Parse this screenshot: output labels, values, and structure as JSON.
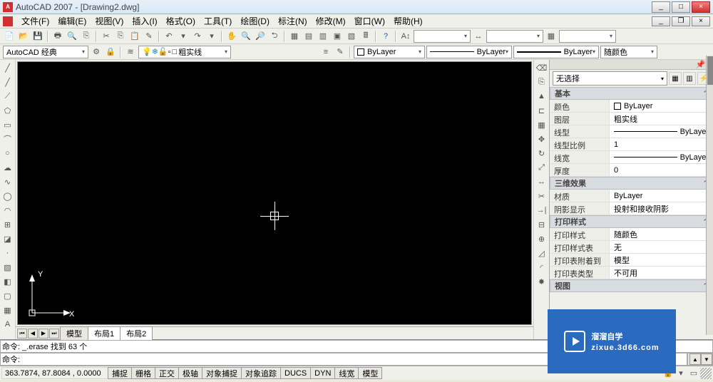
{
  "title": "AutoCAD 2007 - [Drawing2.dwg]",
  "menus": [
    "文件(F)",
    "编辑(E)",
    "视图(V)",
    "插入(I)",
    "格式(O)",
    "工具(T)",
    "绘图(D)",
    "标注(N)",
    "修改(M)",
    "窗口(W)",
    "帮助(H)"
  ],
  "workspace_combo": "AutoCAD 经典",
  "layer_combo": "粗实线",
  "color_combo": "随颜色",
  "line_panel": {
    "color": "ByLayer",
    "ltype": "ByLayer",
    "lweight": "ByLayer"
  },
  "tabs": {
    "items": [
      "模型",
      "布局1",
      "布局2"
    ],
    "active": 0
  },
  "cmd": {
    "history": "命令: _.erase  找到  63 个",
    "prompt": "命令:"
  },
  "status": {
    "coord": "363.7874, 87.8084 , 0.0000",
    "buttons": [
      "捕捉",
      "栅格",
      "正交",
      "极轴",
      "对象捕捉",
      "对象追踪",
      "DUCS",
      "DYN",
      "线宽",
      "模型"
    ]
  },
  "props": {
    "selection": "无选择",
    "groups": [
      {
        "title": "基本",
        "rows": [
          {
            "k": "颜色",
            "v": "ByLayer",
            "swatch": true
          },
          {
            "k": "图层",
            "v": "粗实线"
          },
          {
            "k": "线型",
            "v": "ByLayer",
            "line": true
          },
          {
            "k": "线型比例",
            "v": "1"
          },
          {
            "k": "线宽",
            "v": "ByLayer",
            "line": true
          },
          {
            "k": "厚度",
            "v": "0"
          }
        ]
      },
      {
        "title": "三维效果",
        "rows": [
          {
            "k": "材质",
            "v": "ByLayer"
          },
          {
            "k": "阴影显示",
            "v": "投射和接收阴影"
          }
        ]
      },
      {
        "title": "打印样式",
        "rows": [
          {
            "k": "打印样式",
            "v": "随颜色"
          },
          {
            "k": "打印样式表",
            "v": "无"
          },
          {
            "k": "打印表附着到",
            "v": "模型"
          },
          {
            "k": "打印表类型",
            "v": "不可用"
          }
        ]
      },
      {
        "title": "视图",
        "rows": []
      }
    ]
  },
  "watermark": {
    "brand": "溜溜自学",
    "url": "zixue.3d66.com"
  },
  "ucs": {
    "x": "X",
    "y": "Y"
  },
  "layer_swatch": "□"
}
